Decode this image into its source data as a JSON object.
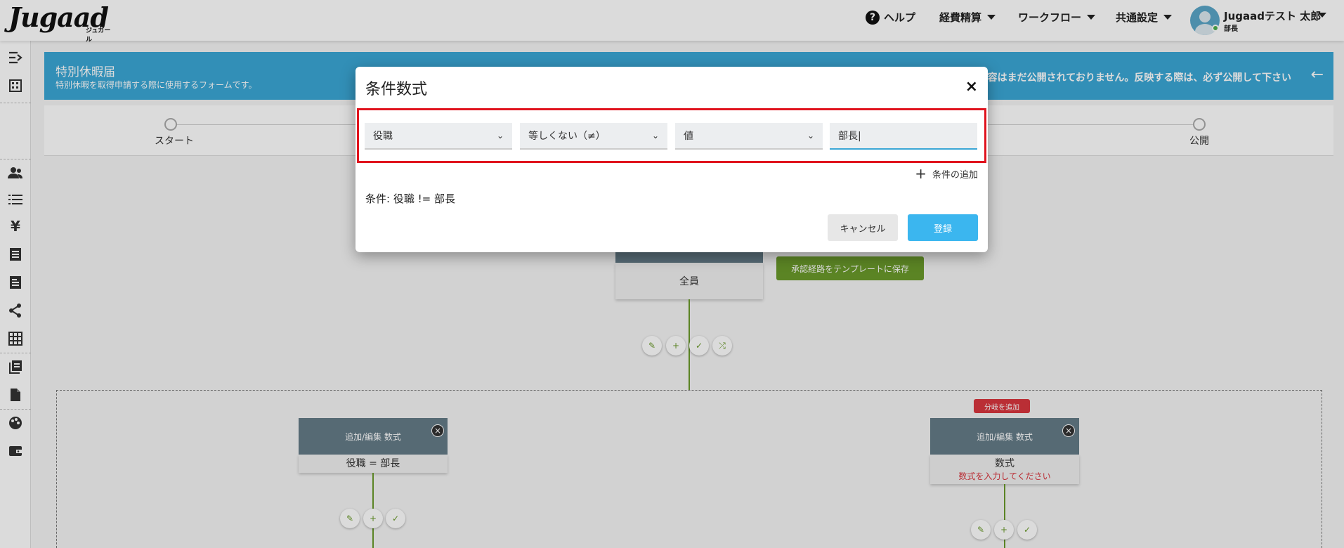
{
  "header": {
    "logo_main": "Jugaad",
    "logo_sub": "ジュガール",
    "help": "ヘルプ",
    "nav": [
      "経費精算",
      "ワークフロー",
      "共通設定"
    ],
    "user_name": "Jugaadテスト 太郎",
    "user_role": "部長"
  },
  "sidebar": {
    "icons": [
      "collapse-icon",
      "building-icon",
      "users-icon",
      "list-icon",
      "yen-icon",
      "receipt-icon",
      "document-icon",
      "share-icon",
      "grid-icon",
      "library-icon",
      "file-icon",
      "palette-icon",
      "wallet-icon"
    ]
  },
  "banner": {
    "title": "特別休暇届",
    "description": "特別休暇を取得申請する際に使用するフォームです。",
    "notice": "内容はまだ公開されておりません。反映する際は、必ず公開して下さい"
  },
  "steps": {
    "start": "スタート",
    "publish": "公開"
  },
  "flow": {
    "all_node": "全員",
    "save_template": "承認経路をテンプレートに保存",
    "branch_add": "分岐を追加",
    "left_node": {
      "head": "追加/編集 数式",
      "body": "役職 = 部長"
    },
    "right_node": {
      "head": "追加/編集 数式",
      "body": "数式",
      "error": "数式を入力してください"
    }
  },
  "modal": {
    "title": "条件数式",
    "close": "×",
    "field1": "役職",
    "field2": "等しくない（≠）",
    "field3": "値",
    "field4": "部長|",
    "add_condition": "条件の追加",
    "summary": "条件: 役職 != 部長",
    "cancel": "キャンセル",
    "submit": "登録"
  }
}
